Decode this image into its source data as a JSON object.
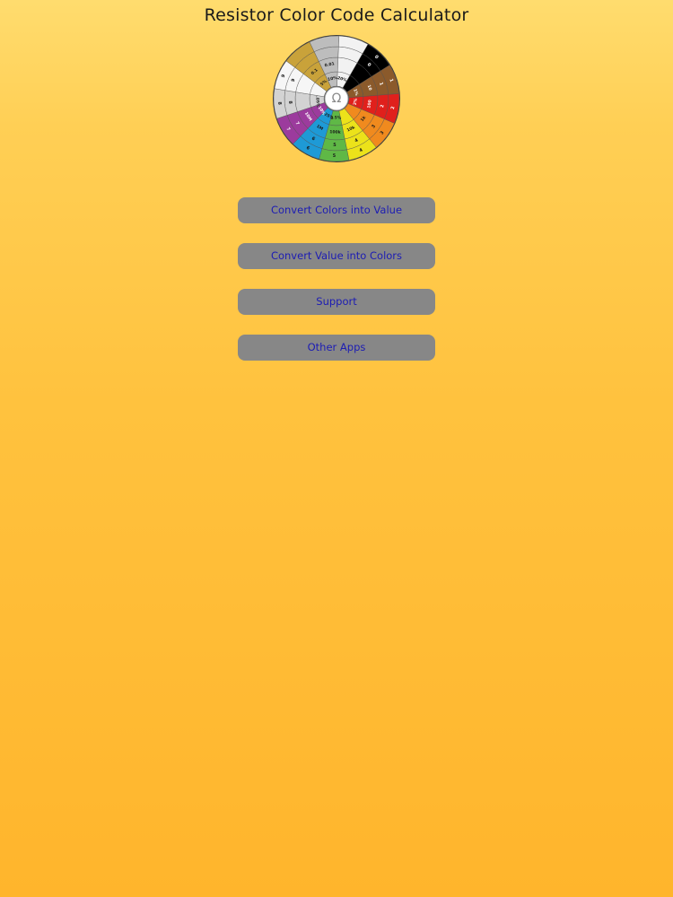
{
  "header": {
    "title": "Resistor Color Code Calculator"
  },
  "wheel": {
    "center_symbol": "Ω",
    "segments": [
      {
        "color": "#000000",
        "digit1": "0",
        "digit2": "0",
        "multiplier": "",
        "tolerance": ""
      },
      {
        "color": "#8b5a2b",
        "digit1": "1",
        "digit2": "1",
        "multiplier": "10",
        "tolerance": "1%"
      },
      {
        "color": "#e0201c",
        "digit1": "2",
        "digit2": "2",
        "multiplier": "100",
        "tolerance": "2%"
      },
      {
        "color": "#f08a1e",
        "digit1": "3",
        "digit2": "3",
        "multiplier": "1k",
        "tolerance": ""
      },
      {
        "color": "#ece21a",
        "digit1": "4",
        "digit2": "4",
        "multiplier": "10k",
        "tolerance": ""
      },
      {
        "color": "#5fb846",
        "digit1": "5",
        "digit2": "5",
        "multiplier": "100k",
        "tolerance": "0.5%"
      },
      {
        "color": "#1e9ad6",
        "digit1": "6",
        "digit2": "6",
        "multiplier": "1M",
        "tolerance": "0.25%"
      },
      {
        "color": "#9c3b9d",
        "digit1": "7",
        "digit2": "7",
        "multiplier": "10M",
        "tolerance": "0.10%"
      },
      {
        "color": "#d3d3d3",
        "digit1": "8",
        "digit2": "8",
        "multiplier": "",
        "tolerance": "0.05%"
      },
      {
        "color": "#f6f6f6",
        "digit1": "9",
        "digit2": "9",
        "multiplier": "",
        "tolerance": ""
      },
      {
        "color": "#c9a23a",
        "digit1": "",
        "digit2": "",
        "multiplier": "0.1",
        "tolerance": "5%"
      },
      {
        "color": "#bdbdbd",
        "digit1": "",
        "digit2": "",
        "multiplier": "0.01",
        "tolerance": "10%"
      },
      {
        "color": "#f2f2f2",
        "digit1": "",
        "digit2": "",
        "multiplier": "",
        "tolerance": "20%"
      }
    ]
  },
  "menu": {
    "items": [
      {
        "label": "Convert Colors into Value"
      },
      {
        "label": "Convert Value into Colors"
      },
      {
        "label": "Support"
      },
      {
        "label": "Other Apps"
      }
    ]
  },
  "colors": {
    "button_bg": "#878787",
    "button_text": "#1c1cb4",
    "background_top": "#ffdc6e",
    "background_bottom": "#ffb52c"
  }
}
